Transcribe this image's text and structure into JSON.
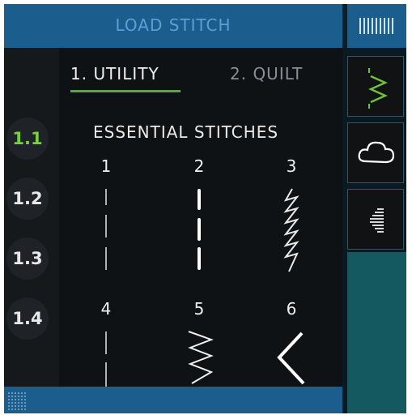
{
  "header": {
    "title": "LOAD STITCH"
  },
  "tabs": [
    {
      "label": "1. UTILITY",
      "active": true
    },
    {
      "label": "2. QUILT",
      "active": false
    }
  ],
  "sidebar": {
    "items": [
      {
        "label": "1.1",
        "active": true
      },
      {
        "label": "1.2",
        "active": false
      },
      {
        "label": "1.3",
        "active": false
      },
      {
        "label": "1.4",
        "active": false
      }
    ]
  },
  "section_title": "ESSENTIAL STITCHES",
  "stitches": [
    {
      "number": "1",
      "icon": "straight-stitch-icon"
    },
    {
      "number": "2",
      "icon": "triple-straight-stitch-icon"
    },
    {
      "number": "3",
      "icon": "stretch-zigzag-stitch-icon"
    },
    {
      "number": "4",
      "icon": "straight-stitch-long-icon"
    },
    {
      "number": "5",
      "icon": "zigzag-stitch-icon"
    },
    {
      "number": "6",
      "icon": "wide-zigzag-stitch-icon"
    }
  ],
  "right_panel": {
    "icons": [
      "stitch-menu-icon",
      "zigzag-stitch-mode-icon",
      "cloud-icon",
      "stitch-density-icon"
    ]
  },
  "colors": {
    "bar_blue": "#1b5d8c",
    "active_green": "#7ad03a",
    "panel_teal": "#14595f"
  }
}
